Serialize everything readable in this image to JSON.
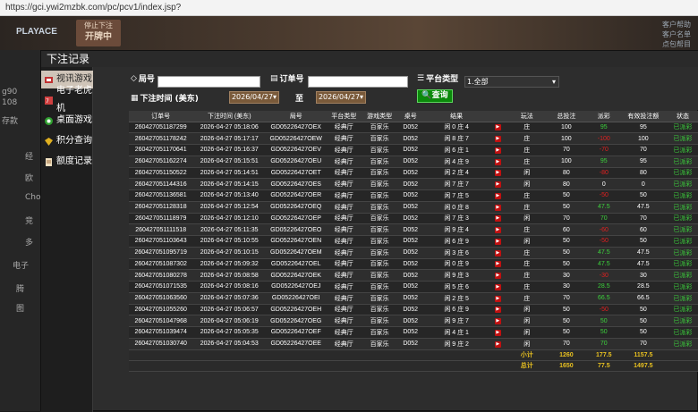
{
  "browser": {
    "url": "https://gci.ywi2mzbk.com/pc/pcv1/index.jsp?"
  },
  "background": {
    "logo": "PLAYACE",
    "stop_label_line1": "停止下注",
    "stop_label_line2": "开牌中",
    "right_info": [
      "客户帮助",
      "客户名单",
      "点包帮目"
    ],
    "left_items": [
      "g90",
      "108",
      "存款",
      "经",
      "欧",
      "Cho",
      "竞",
      "多",
      "电子",
      "腾",
      "图"
    ]
  },
  "dialog": {
    "title": "下注记录",
    "menu": [
      {
        "label": "视讯游戏",
        "icon": "dealer-icon",
        "active": true
      },
      {
        "label": "电子老虎机",
        "icon": "slot-icon",
        "active": false
      },
      {
        "label": "桌面游戏",
        "icon": "table-game-icon",
        "active": false
      },
      {
        "label": "积分查询",
        "icon": "diamond-icon",
        "active": false
      },
      {
        "label": "额度记录",
        "icon": "document-icon",
        "active": false
      }
    ],
    "filters": {
      "game_no_label": "局号",
      "order_no_label": "订单号",
      "platform_label": "平台类型",
      "platform_value": "1.全部",
      "time_label": "下注时间 (美东)",
      "date_from": "2026/04/27",
      "to_label": "至",
      "date_to": "2026/04/27",
      "query_button": "查询"
    },
    "table": {
      "headers": [
        "订单号",
        "下注时间 (美东)",
        "局号",
        "平台类型",
        "游戏类型",
        "桌号",
        "结果",
        "",
        "玩法",
        "总投注",
        "派彩",
        "有效投注额",
        "状态"
      ],
      "rows": [
        [
          "260427051187299",
          "2026-04-27 05:18:06",
          "GD05226427OEX",
          "经典厅",
          "百家乐",
          "D052",
          "闲 0 庄 4",
          "庄",
          "100",
          "95",
          "95",
          "已派彩"
        ],
        [
          "260427051178242",
          "2026-04-27 05:17:17",
          "GD05226427OEW",
          "经典厅",
          "百家乐",
          "D052",
          "闲 8 庄 7",
          "庄",
          "100",
          "-100",
          "100",
          "已派彩"
        ],
        [
          "260427051170641",
          "2026-04-27 05:16:37",
          "GD05226427OEV",
          "经典厅",
          "百家乐",
          "D052",
          "闲 6 庄 1",
          "庄",
          "70",
          "-70",
          "70",
          "已派彩"
        ],
        [
          "260427051162274",
          "2026-04-27 05:15:51",
          "GD05226427OEU",
          "经典厅",
          "百家乐",
          "D052",
          "闲 4 庄 9",
          "庄",
          "100",
          "95",
          "95",
          "已派彩"
        ],
        [
          "260427051150522",
          "2026-04-27 05:14:51",
          "GD05226427OET",
          "经典厅",
          "百家乐",
          "D052",
          "闲 2 庄 4",
          "闲",
          "80",
          "-80",
          "80",
          "已派彩"
        ],
        [
          "260427051144316",
          "2026-04-27 05:14:15",
          "GD05226427OES",
          "经典厅",
          "百家乐",
          "D052",
          "闲 7 庄 7",
          "闲",
          "80",
          "0",
          "0",
          "已派彩"
        ],
        [
          "260427051136581",
          "2026-04-27 05:13:40",
          "GD05226427OER",
          "经典厅",
          "百家乐",
          "D052",
          "闲 7 庄 5",
          "庄",
          "50",
          "-50",
          "50",
          "已派彩"
        ],
        [
          "260427051128318",
          "2026-04-27 05:12:54",
          "GD05226427OEQ",
          "经典厅",
          "百家乐",
          "D052",
          "闲 0 庄 8",
          "庄",
          "50",
          "47.5",
          "47.5",
          "已派彩"
        ],
        [
          "260427051118979",
          "2026-04-27 05:12:10",
          "GD05226427OEP",
          "经典厅",
          "百家乐",
          "D052",
          "闲 7 庄 3",
          "闲",
          "70",
          "70",
          "70",
          "已派彩"
        ],
        [
          "260427051111518",
          "2026-04-27 05:11:35",
          "GD05226427OEO",
          "经典厅",
          "百家乐",
          "D052",
          "闲 9 庄 4",
          "庄",
          "60",
          "-60",
          "60",
          "已派彩"
        ],
        [
          "260427051103643",
          "2026-04-27 05:10:55",
          "GD05226427OEN",
          "经典厅",
          "百家乐",
          "D052",
          "闲 6 庄 9",
          "闲",
          "50",
          "-50",
          "50",
          "已派彩"
        ],
        [
          "260427051095719",
          "2026-04-27 05:10:15",
          "GD05226427OEM",
          "经典厅",
          "百家乐",
          "D052",
          "闲 3 庄 6",
          "庄",
          "50",
          "47.5",
          "47.5",
          "已派彩"
        ],
        [
          "260427051087302",
          "2026-04-27 05:09:32",
          "GD05226427OEL",
          "经典厅",
          "百家乐",
          "D052",
          "闲 0 庄 9",
          "庄",
          "50",
          "47.5",
          "47.5",
          "已派彩"
        ],
        [
          "260427051080278",
          "2026-04-27 05:08:58",
          "GD05226427OEK",
          "经典厅",
          "百家乐",
          "D052",
          "闲 9 庄 3",
          "庄",
          "30",
          "-30",
          "30",
          "已派彩"
        ],
        [
          "260427051071535",
          "2026-04-27 05:08:16",
          "GD05226427OEJ",
          "经典厅",
          "百家乐",
          "D052",
          "闲 5 庄 6",
          "庄",
          "30",
          "28.5",
          "28.5",
          "已派彩"
        ],
        [
          "260427051063560",
          "2026-04-27 05:07:36",
          "GD05226427OEI",
          "经典厅",
          "百家乐",
          "D052",
          "闲 2 庄 5",
          "庄",
          "70",
          "66.5",
          "66.5",
          "已派彩"
        ],
        [
          "260427051055260",
          "2026-04-27 05:06:57",
          "GD05226427OEH",
          "经典厅",
          "百家乐",
          "D052",
          "闲 6 庄 9",
          "闲",
          "50",
          "-50",
          "50",
          "已派彩"
        ],
        [
          "260427051047968",
          "2026-04-27 05:06:19",
          "GD05226427OEG",
          "经典厅",
          "百家乐",
          "D052",
          "闲 9 庄 7",
          "闲",
          "50",
          "50",
          "50",
          "已派彩"
        ],
        [
          "260427051039474",
          "2026-04-27 05:05:35",
          "GD05226427OEF",
          "经典厅",
          "百家乐",
          "D052",
          "闲 4 庄 1",
          "闲",
          "50",
          "50",
          "50",
          "已派彩"
        ],
        [
          "260427051030740",
          "2026-04-27 05:04:53",
          "GD05226427OEE",
          "经典厅",
          "百家乐",
          "D052",
          "闲 9 庄 2",
          "闲",
          "70",
          "70",
          "70",
          "已派彩"
        ]
      ],
      "subtotal": {
        "label": "小计",
        "total_bet": "1260",
        "payout": "177.5",
        "valid": "1157.5"
      },
      "total": {
        "label": "总计",
        "total_bet": "1650",
        "payout": "77.5",
        "valid": "1497.5"
      }
    }
  },
  "colors": {
    "win": "#3cd03c",
    "loss": "#e02020",
    "status": "#3cd03c",
    "query": "#0b8a0b"
  }
}
